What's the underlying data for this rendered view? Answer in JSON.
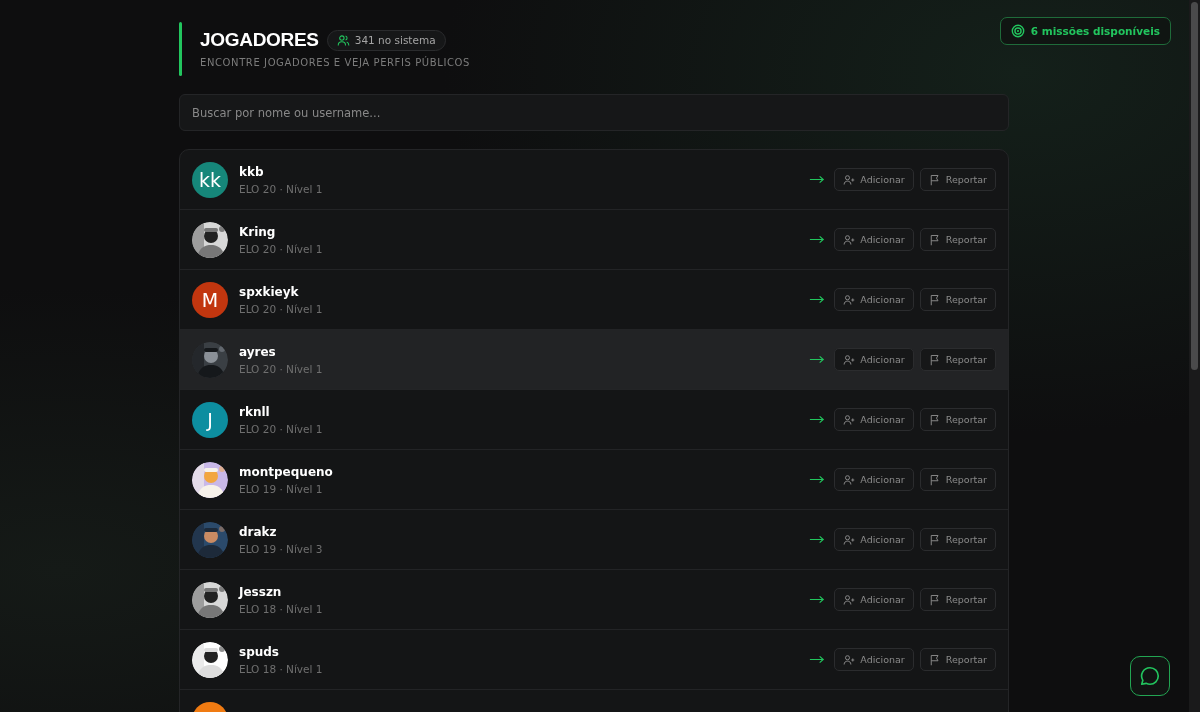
{
  "header": {
    "title": "JOGADORES",
    "count_badge": "341 no sistema",
    "subtitle": "ENCONTRE JOGADORES E VEJA PERFIS PÚBLICOS"
  },
  "missions_button": "6 missões disponíveis",
  "search": {
    "placeholder": "Buscar por nome ou username..."
  },
  "players": [
    {
      "name": "kkb",
      "meta": "ELO 20 · Nível 1",
      "avatar": {
        "kind": "letter",
        "letter": "kk",
        "color": "#16877a"
      },
      "selected": false,
      "add": "Adicionar",
      "report": "Reportar"
    },
    {
      "name": "Kring",
      "meta": "ELO 20 · Nível 1",
      "selected": false,
      "add": "Adicionar",
      "report": "Reportar"
    },
    {
      "name": "spxkieyk",
      "meta": "ELO 20 · Nível 1",
      "avatar": {
        "kind": "letter",
        "letter": "M",
        "color": "#c2360f"
      },
      "selected": false,
      "add": "Adicionar",
      "report": "Reportar"
    },
    {
      "name": "ayres",
      "meta": "ELO 20 · Nível 1",
      "selected": true,
      "add": "Adicionar",
      "report": "Reportar"
    },
    {
      "name": "rknll",
      "meta": "ELO 20 · Nível 1",
      "avatar": {
        "kind": "letter",
        "letter": "J",
        "color": "#0d8ea0"
      },
      "selected": false,
      "add": "Adicionar",
      "report": "Reportar"
    },
    {
      "name": "montpequeno",
      "meta": "ELO 19 · Nível 1",
      "selected": false,
      "add": "Adicionar",
      "report": "Reportar"
    },
    {
      "name": "drakz",
      "meta": "ELO 19 · Nível 3",
      "selected": false,
      "add": "Adicionar",
      "report": "Reportar"
    },
    {
      "name": "Jesszn",
      "meta": "ELO 18 · Nível 1",
      "selected": false,
      "add": "Adicionar",
      "report": "Reportar"
    },
    {
      "name": "spuds",
      "meta": "ELO 18 · Nível 1",
      "selected": false,
      "add": "Adicionar",
      "report": "Reportar"
    },
    {
      "avatar": {
        "kind": "letter",
        "color": "#f07b12"
      },
      "selected": false
    }
  ]
}
